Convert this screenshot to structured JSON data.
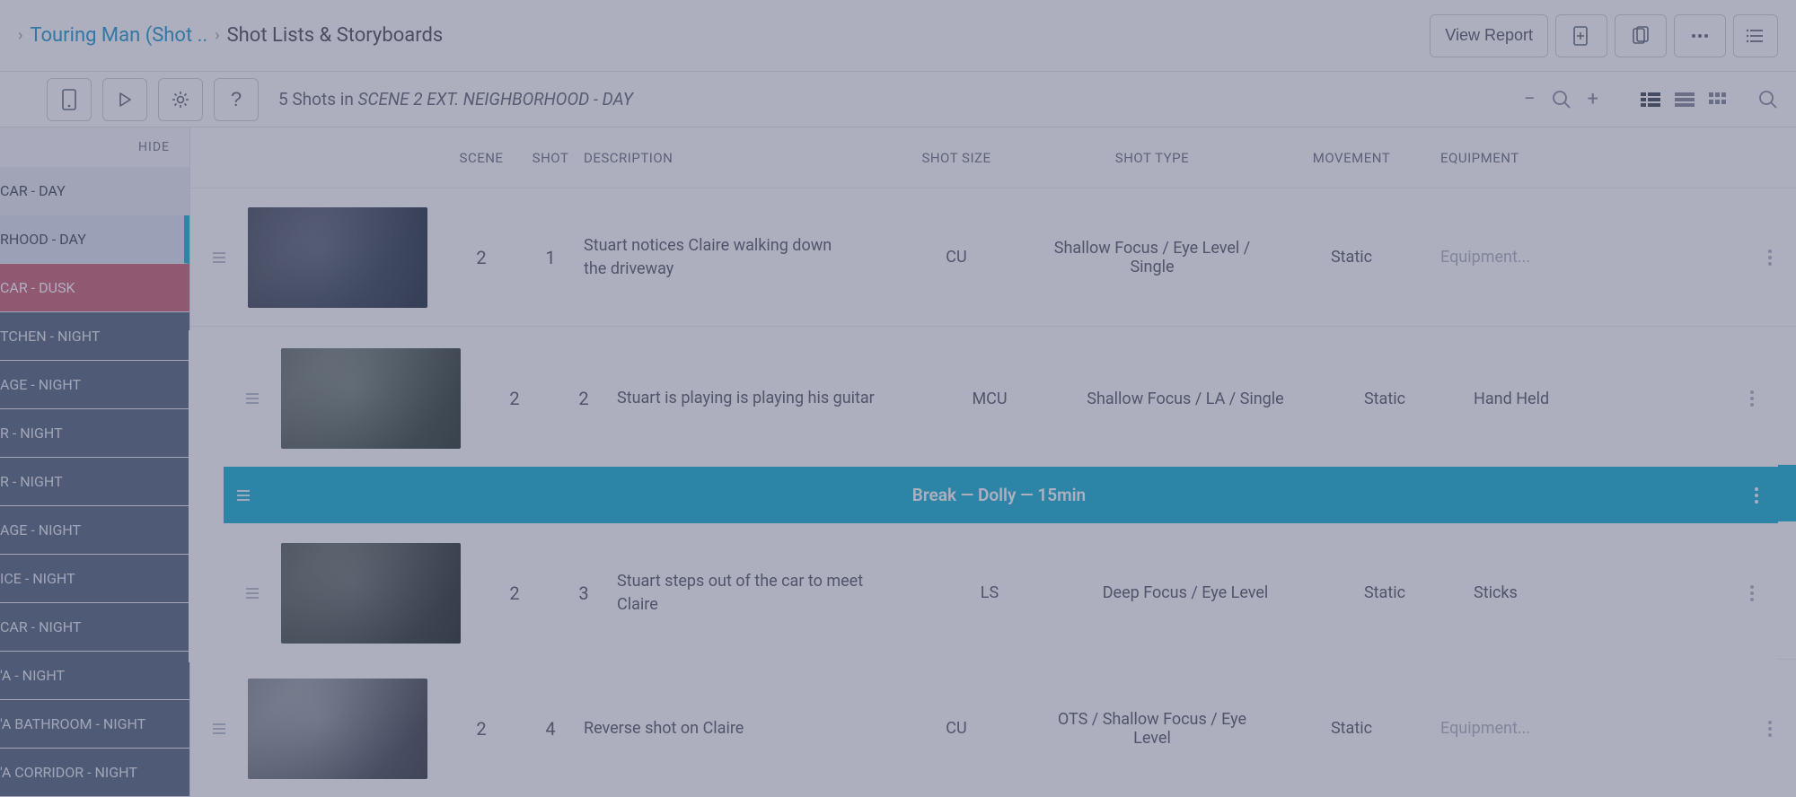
{
  "breadcrumbs": {
    "parent": "Touring Man (Shot ..",
    "current": "Shot Lists & Storyboards"
  },
  "header_actions": {
    "view_report": "View Report"
  },
  "toolbar": {
    "shot_count_prefix": "5 Shots in ",
    "scene_label": "SCENE 2 EXT. NEIGHBORHOOD - DAY"
  },
  "sidebar": {
    "hide_label": "HIDE",
    "scenes": [
      "CAR - DAY",
      "RHOOD - DAY",
      "CAR - DUSK",
      "TCHEN - NIGHT",
      "AGE - NIGHT",
      "R - NIGHT",
      "R - NIGHT",
      "AGE - NIGHT",
      "ICE - NIGHT",
      "CAR - NIGHT",
      "'A - NIGHT",
      "'A BATHROOM - NIGHT",
      "'A CORRIDOR - NIGHT"
    ]
  },
  "columns": {
    "scene": "SCENE",
    "shot": "SHOT",
    "description": "DESCRIPTION",
    "shot_size": "SHOT SIZE",
    "shot_type": "SHOT TYPE",
    "movement": "MOVEMENT",
    "equipment": "EQUIPMENT"
  },
  "shots": [
    {
      "scene": "2",
      "shot": "1",
      "description": "Stuart notices Claire walking down the driveway",
      "size": "CU",
      "type": "Shallow Focus / Eye Level / Single",
      "movement": "Static",
      "equipment": "Equipment...",
      "equip_placeholder": true
    },
    {
      "scene": "2",
      "shot": "2",
      "description": "Stuart is playing is playing his guitar",
      "size": "MCU",
      "type": "Shallow Focus / LA / Single",
      "movement": "Static",
      "equipment": "Hand Held",
      "equip_placeholder": false
    },
    {
      "scene": "2",
      "shot": "3",
      "description": "Stuart steps out of the car to meet Claire",
      "size": "LS",
      "type": "Deep Focus / Eye Level",
      "movement": "Static",
      "equipment": "Sticks",
      "equip_placeholder": false
    },
    {
      "scene": "2",
      "shot": "4",
      "description": "Reverse shot on Claire",
      "size": "CU",
      "type": "OTS / Shallow Focus / Eye Level",
      "movement": "Static",
      "equipment": "Equipment...",
      "equip_placeholder": true
    }
  ],
  "break": {
    "label": "Break — Dolly — 15min"
  }
}
